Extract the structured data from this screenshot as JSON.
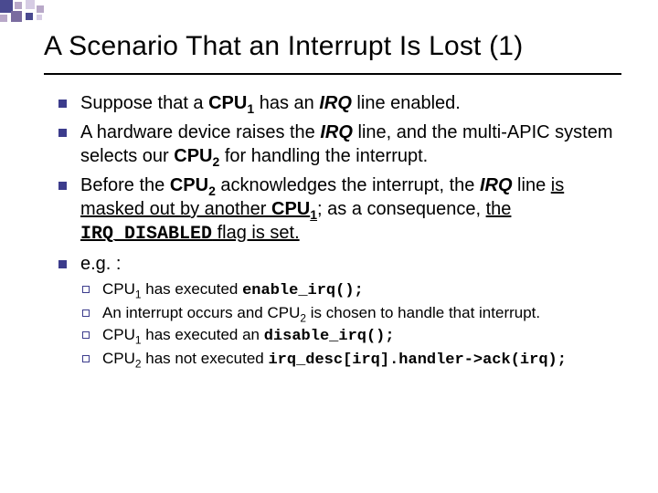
{
  "deco_colors": {
    "dark": "#4a4a90",
    "light": "#b8a8c8",
    "mid": "#7a6ca0",
    "pale": "#d6cce4"
  },
  "title": "A Scenario That an Interrupt Is Lost (1)",
  "bullets": [
    {
      "parts": [
        {
          "t": "Suppose that a "
        },
        {
          "t": "CPU",
          "cls": "b"
        },
        {
          "t": "1",
          "cls": "b",
          "sub": true
        },
        {
          "t": " has an "
        },
        {
          "t": "IRQ",
          "cls": "bi"
        },
        {
          "t": " line enabled."
        }
      ]
    },
    {
      "parts": [
        {
          "t": "A hardware device raises the "
        },
        {
          "t": "IRQ",
          "cls": "bi"
        },
        {
          "t": " line, and the multi-APIC system selects our "
        },
        {
          "t": "CPU",
          "cls": "b"
        },
        {
          "t": "2",
          "cls": "b",
          "sub": true
        },
        {
          "t": " for handling the interrupt."
        }
      ]
    },
    {
      "parts": [
        {
          "t": "Before the "
        },
        {
          "t": "CPU",
          "cls": "b"
        },
        {
          "t": "2",
          "cls": "b",
          "sub": true
        },
        {
          "t": " acknowledges the interrupt, the "
        },
        {
          "t": "IRQ",
          "cls": "bi"
        },
        {
          "t": " line "
        },
        {
          "t": "is masked out by another ",
          "cls": "u"
        },
        {
          "t": "CPU",
          "cls": "b u"
        },
        {
          "t": "1",
          "cls": "b u",
          "sub": true
        },
        {
          "t": "; as a consequence, "
        },
        {
          "t": "the ",
          "cls": "u"
        },
        {
          "t": "IRQ_DISABLED",
          "cls": "code u"
        },
        {
          "t": " flag is set.",
          "cls": "u"
        }
      ]
    },
    {
      "parts": [
        {
          "t": "e.g. :"
        }
      ],
      "sub": [
        {
          "parts": [
            {
              "t": "CPU"
            },
            {
              "t": "1",
              "sub": true
            },
            {
              "t": " has executed "
            },
            {
              "t": "enable_irq();",
              "cls": "code"
            }
          ]
        },
        {
          "parts": [
            {
              "t": "An interrupt occurs and CPU"
            },
            {
              "t": "2",
              "sub": true
            },
            {
              "t": " is chosen to handle that interrupt."
            }
          ]
        },
        {
          "parts": [
            {
              "t": "CPU"
            },
            {
              "t": "1",
              "sub": true
            },
            {
              "t": " has executed an "
            },
            {
              "t": "disable_irq();",
              "cls": "code"
            }
          ]
        },
        {
          "parts": [
            {
              "t": "CPU"
            },
            {
              "t": "2",
              "sub": true
            },
            {
              "t": " has not executed "
            },
            {
              "t": "irq_desc[irq].handler->ack(irq);",
              "cls": "code"
            }
          ]
        }
      ]
    }
  ]
}
